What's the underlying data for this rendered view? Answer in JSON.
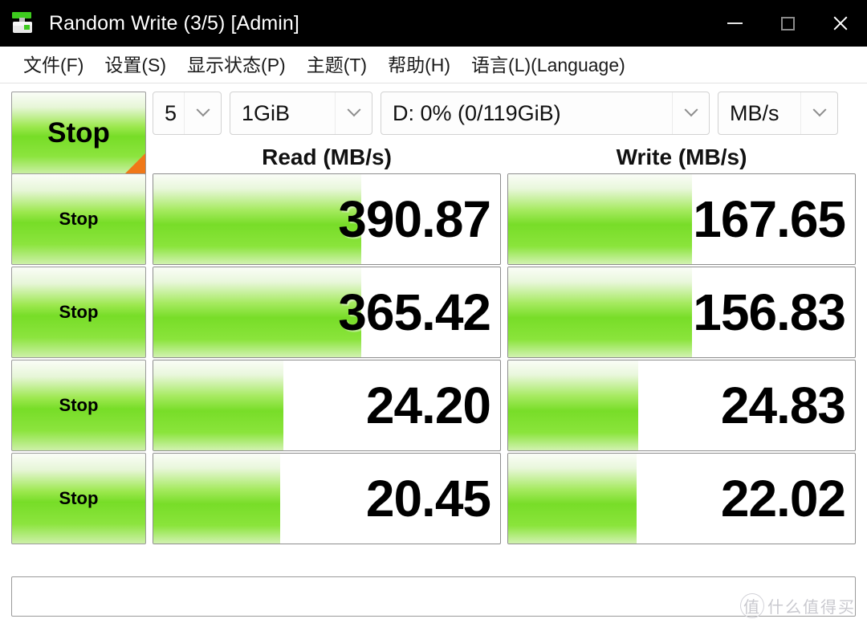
{
  "window": {
    "title": "Random Write (3/5) [Admin]",
    "icon": "diskmark-app-icon",
    "controls": {
      "minimize": "minimize-icon",
      "maximize": "maximize-icon",
      "close": "close-icon"
    }
  },
  "menu": {
    "items": [
      {
        "label": "文件(F)"
      },
      {
        "label": "设置(S)"
      },
      {
        "label": "显示状态(P)"
      },
      {
        "label": "主题(T)"
      },
      {
        "label": "帮助(H)"
      },
      {
        "label": "语言(L)(Language)"
      }
    ]
  },
  "toolbar": {
    "all_button_label": "Stop",
    "test_count": "5",
    "test_size": "1GiB",
    "target_drive": "D: 0% (0/119GiB)",
    "unit": "MB/s",
    "dropdown_icon": "chevron-down-icon"
  },
  "headers": {
    "read": "Read (MB/s)",
    "write": "Write (MB/s)"
  },
  "rows": [
    {
      "button_label": "Stop",
      "read_value": "390.87",
      "write_value": "167.65",
      "read_fill_pct": 60,
      "write_fill_pct": 53
    },
    {
      "button_label": "Stop",
      "read_value": "365.42",
      "write_value": "156.83",
      "read_fill_pct": 60,
      "write_fill_pct": 53
    },
    {
      "button_label": "Stop",
      "read_value": "24.20",
      "write_value": "24.83",
      "read_fill_pct": 37.5,
      "write_fill_pct": 37.5
    },
    {
      "button_label": "Stop",
      "read_value": "20.45",
      "write_value": "22.02",
      "read_fill_pct": 36.5,
      "write_fill_pct": 37
    }
  ],
  "statusbar": {
    "text": ""
  },
  "watermark": {
    "mark": "值",
    "text": "什么值得买"
  },
  "colors": {
    "titlebar_bg": "#000000",
    "titlebar_text": "#ffffff",
    "bar_green": "#78dd28",
    "bar_green_light": "#d2f2b1",
    "corner_orange": "#f07818",
    "border_grey": "#8d8d8d"
  }
}
